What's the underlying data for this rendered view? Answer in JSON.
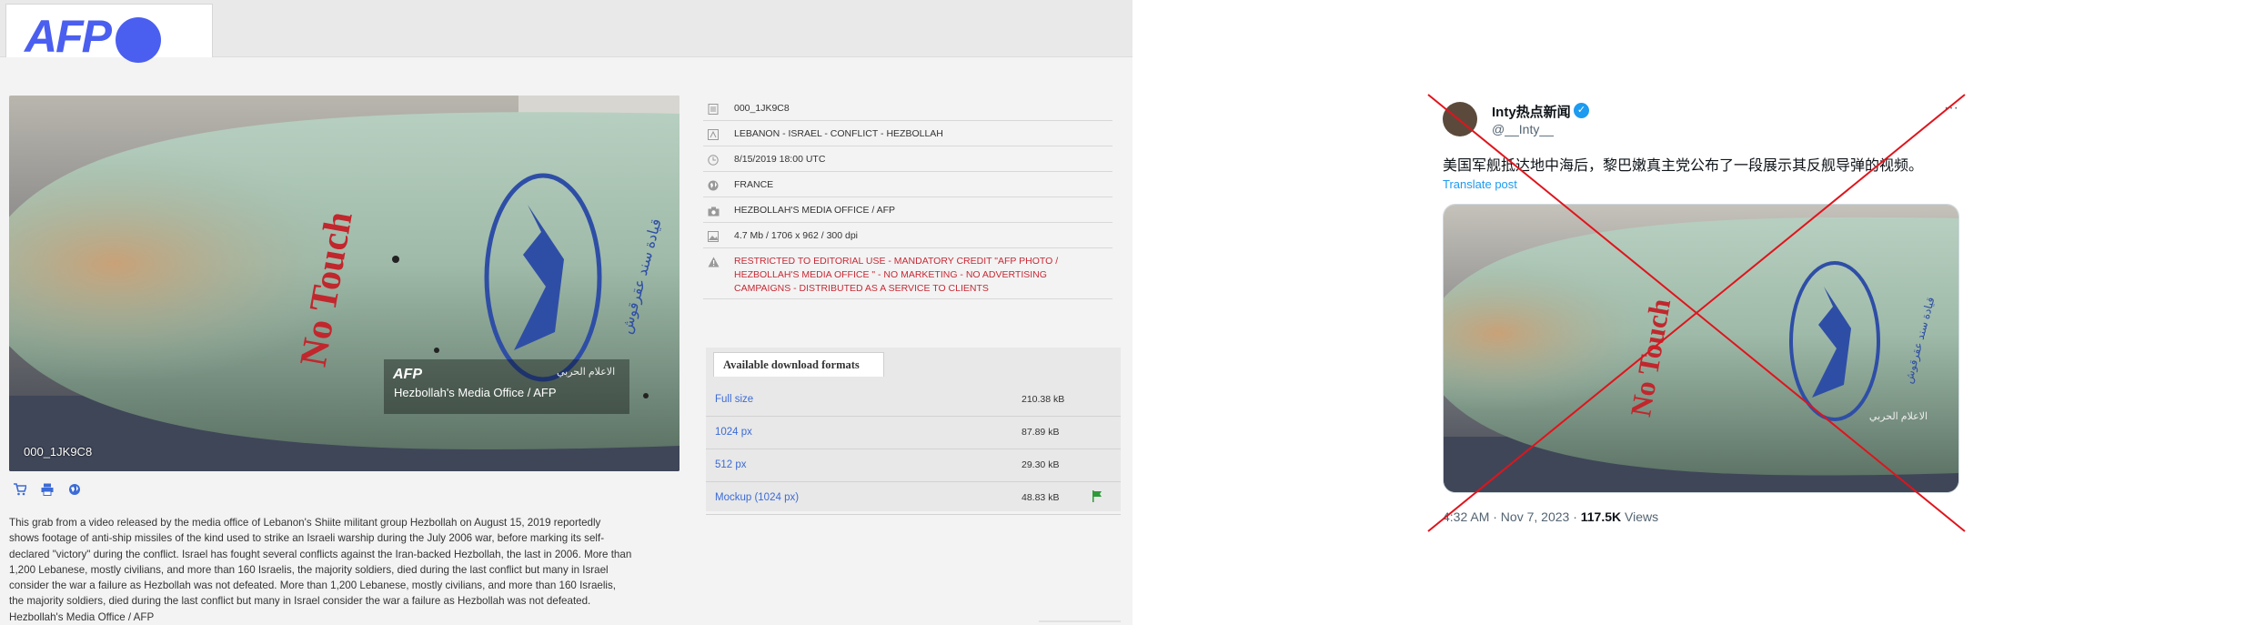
{
  "afp": {
    "logo": "AFP",
    "photo_id": "000_1JK9C8",
    "watermark_brand": "AFP",
    "watermark_credit": "Hezbollah's Media Office / AFP",
    "watermark_arabic": "الاعلام الحربي",
    "missile_text": "No Touch",
    "missile_arabic": "قيادة سند عقرقوش",
    "icons": [
      "cart-icon",
      "print-icon",
      "globe-icon"
    ],
    "caption": [
      "This grab from a video released by the media office of Lebanon's Shiite militant group Hezbollah on August 15, 2019 reportedly",
      "shows footage of anti-ship missiles of the kind used to strike an Israeli warship during the July 2006 war, before marking its self-",
      "declared \"victory\" during the conflict. Israel has fought several conflicts against the Iran-backed Hezbollah, the last in 2006. More than",
      "1,200 Lebanese, mostly civilians, and more than 160 Israelis, the majority soldiers, died during the last conflict but many in Israel",
      "consider the war a failure as Hezbollah was not defeated. More than 1,200 Lebanese, mostly civilians, and more than 160 Israelis,",
      "the majority soldiers, died during the last conflict but many in Israel consider the war a failure as Hezbollah was not defeated.",
      "Hezbollah's Media Office / AFP"
    ],
    "meta": [
      {
        "icon": "file-icon",
        "text": "000_1JK9C8"
      },
      {
        "icon": "title-icon",
        "text": "LEBANON - ISRAEL - CONFLICT - HEZBOLLAH"
      },
      {
        "icon": "clock-icon",
        "text": "8/15/2019 18:00 UTC"
      },
      {
        "icon": "globe-icon",
        "text": "FRANCE"
      },
      {
        "icon": "camera-icon",
        "text": "HEZBOLLAH'S MEDIA OFFICE / AFP"
      },
      {
        "icon": "image-icon",
        "text": "4.7 Mb / 1706 x 962 / 300 dpi"
      },
      {
        "icon": "warning-icon",
        "lines": [
          "RESTRICTED TO EDITORIAL USE - MANDATORY CREDIT \"AFP PHOTO /",
          "HEZBOLLAH'S MEDIA OFFICE \" - NO MARKETING - NO ADVERTISING",
          "CAMPAIGNS - DISTRIBUTED AS A SERVICE TO CLIENTS"
        ]
      }
    ],
    "downloads": {
      "tab_label": "Available download formats",
      "rows": [
        {
          "label": "Full size",
          "size": "210.38 kB"
        },
        {
          "label": "1024 px",
          "size": "87.89 kB"
        },
        {
          "label": "512 px",
          "size": "29.30 kB"
        },
        {
          "label": "Mockup (1024 px)",
          "size": "48.83 kB"
        }
      ]
    }
  },
  "tweet": {
    "name": "Inty热点新闻",
    "handle": "@__Inty__",
    "more": "···",
    "text": "美国军舰抵达地中海后，黎巴嫩真主党公布了一段展示其反舰导弹的视频。",
    "translate": "Translate post",
    "time": "4:32 AM · Nov 7, 2023 · ",
    "views_count": "117.5K",
    "views_label": " Views",
    "missile_text": "No Touch",
    "missile_arabic": "قيادة سند عقرقوش",
    "watermark_arabic": "الاعلام الحربي"
  },
  "colors": {
    "afp_blue": "#4a5ef0",
    "link_blue": "#3c6bd6",
    "restricted_red": "#c62a35",
    "cross_red": "#e0141c",
    "twitter_blue": "#1d9bf0"
  }
}
